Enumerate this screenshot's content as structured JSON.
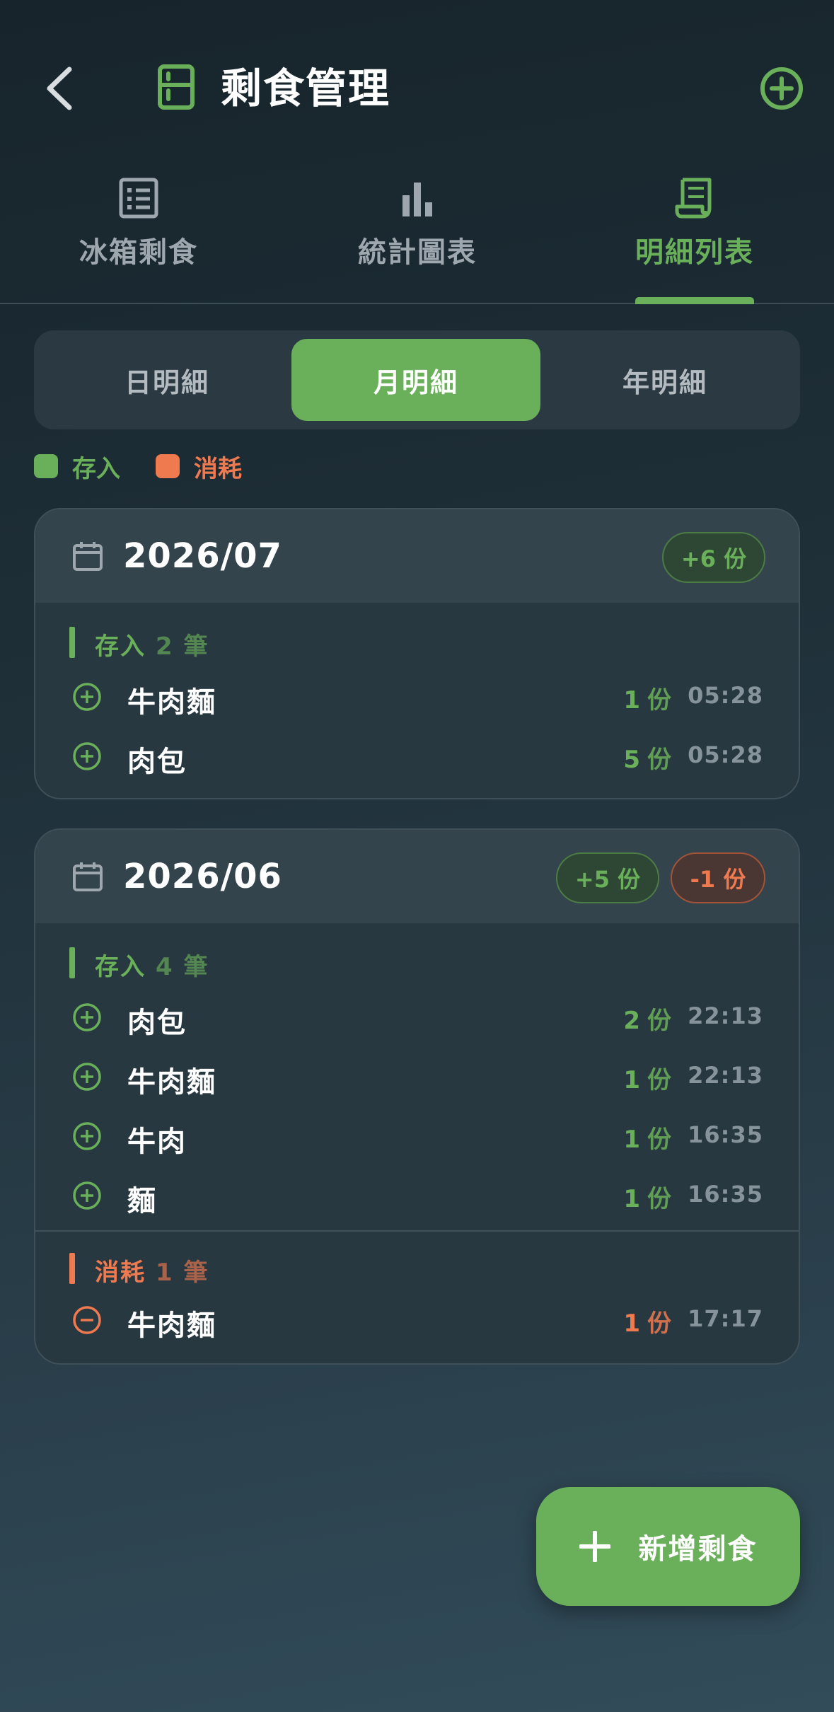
{
  "header": {
    "title": "剩食管理",
    "icons": {
      "back": "chevron-left-icon",
      "title": "fridge-icon",
      "add": "plus-circle-icon"
    }
  },
  "tabs": [
    {
      "label": "冰箱剩食",
      "icon": "list-icon",
      "active": false
    },
    {
      "label": "統計圖表",
      "icon": "bar-chart-icon",
      "active": false
    },
    {
      "label": "明細列表",
      "icon": "receipt-icon",
      "active": true
    }
  ],
  "segments": [
    {
      "label": "日明細",
      "active": false
    },
    {
      "label": "月明細",
      "active": true
    },
    {
      "label": "年明細",
      "active": false
    }
  ],
  "legend": [
    {
      "label": "存入",
      "color": "#6ab05a"
    },
    {
      "label": "消耗",
      "color": "#f07a50"
    }
  ],
  "colors": {
    "accent": "#6ab05a",
    "consume": "#f07a50"
  },
  "months": [
    {
      "title": "2026/07",
      "in_badge": "+6 份",
      "in_section": {
        "label": "存入",
        "count": "2 筆"
      },
      "in_rows": [
        {
          "name": "牛肉麵",
          "qty": "1",
          "unit": "份",
          "time": "05:28"
        },
        {
          "name": "肉包",
          "qty": "5",
          "unit": "份",
          "time": "05:28"
        }
      ]
    },
    {
      "title": "2026/06",
      "in_badge": "+5 份",
      "out_badge": "-1 份",
      "in_section": {
        "label": "存入",
        "count": "4 筆"
      },
      "in_rows": [
        {
          "name": "肉包",
          "qty": "2",
          "unit": "份",
          "time": "22:13"
        },
        {
          "name": "牛肉麵",
          "qty": "1",
          "unit": "份",
          "time": "22:13"
        },
        {
          "name": "牛肉",
          "qty": "1",
          "unit": "份",
          "time": "16:35"
        },
        {
          "name": "麵",
          "qty": "1",
          "unit": "份",
          "time": "16:35"
        }
      ],
      "out_section": {
        "label": "消耗",
        "count": "1 筆"
      },
      "out_rows": [
        {
          "name": "牛肉麵",
          "qty": "1",
          "unit": "份",
          "time": "17:17"
        }
      ]
    }
  ],
  "fab": {
    "label": "新增剩食",
    "icon": "plus-icon"
  }
}
